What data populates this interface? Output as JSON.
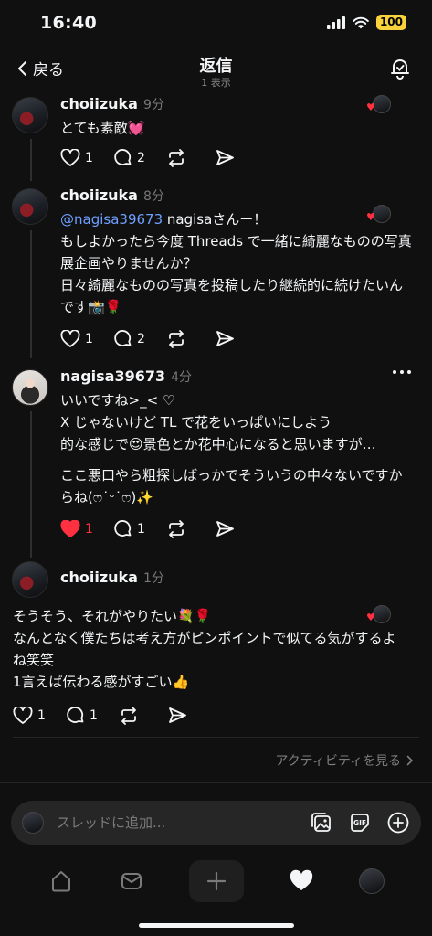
{
  "status": {
    "time": "16:40",
    "battery": "100"
  },
  "header": {
    "back_label": "戻る",
    "title": "返信",
    "subtitle": "1 表示"
  },
  "posts": [
    {
      "username": "choiizuka",
      "time": "9分",
      "lines": [
        "とても素敵💓"
      ],
      "likes": "1",
      "replies": "2",
      "liked": false
    },
    {
      "username": "choiizuka",
      "time": "8分",
      "mention": "@nagisa39673",
      "lines": [
        " nagisaさんー！",
        "もしよかったら今度 Threads で一緒に綺麗なものの写真",
        "展企画やりませんか？",
        "日々綺麗なものの写真を投稿したり継続的に続けたいん",
        "です📸🌹"
      ],
      "likes": "1",
      "replies": "2",
      "liked": false
    },
    {
      "username": "nagisa39673",
      "time": "4分",
      "lines": [
        "いいですね>_< ♡",
        "X じゃないけど TL で花をいっぱいにしよう",
        "的な感じで😍景色とか花中心になると思いますが…",
        "",
        "ここ悪口やら粗探しばっかでそういうの中々ないですか",
        "らね(ෆ˙ᵕ˙ෆ)✨"
      ],
      "likes": "1",
      "replies": "1",
      "liked": true
    },
    {
      "username": "choiizuka",
      "time": "1分",
      "lines": [
        "そうそう、それがやりたい💐🌹",
        "なんとなく僕たちは考え方がピンポイントで似てる気がするよ",
        "ね笑笑",
        "1言えば伝わる感がすごい👍"
      ],
      "likes": "1",
      "replies": "1",
      "liked": false
    }
  ],
  "activity_link": "アクティビティを見る",
  "composer": {
    "placeholder": "スレッドに追加..."
  },
  "colors": {
    "like_active": "#ff3040",
    "mention": "#6fa0ff"
  },
  "icons": [
    "chevron-left-icon",
    "notification-icon",
    "heart-icon",
    "comment-icon",
    "repost-icon",
    "share-icon",
    "image-icon",
    "gif-icon",
    "add-icon",
    "home-icon",
    "inbox-icon",
    "plus-icon",
    "heart-filled-icon"
  ]
}
